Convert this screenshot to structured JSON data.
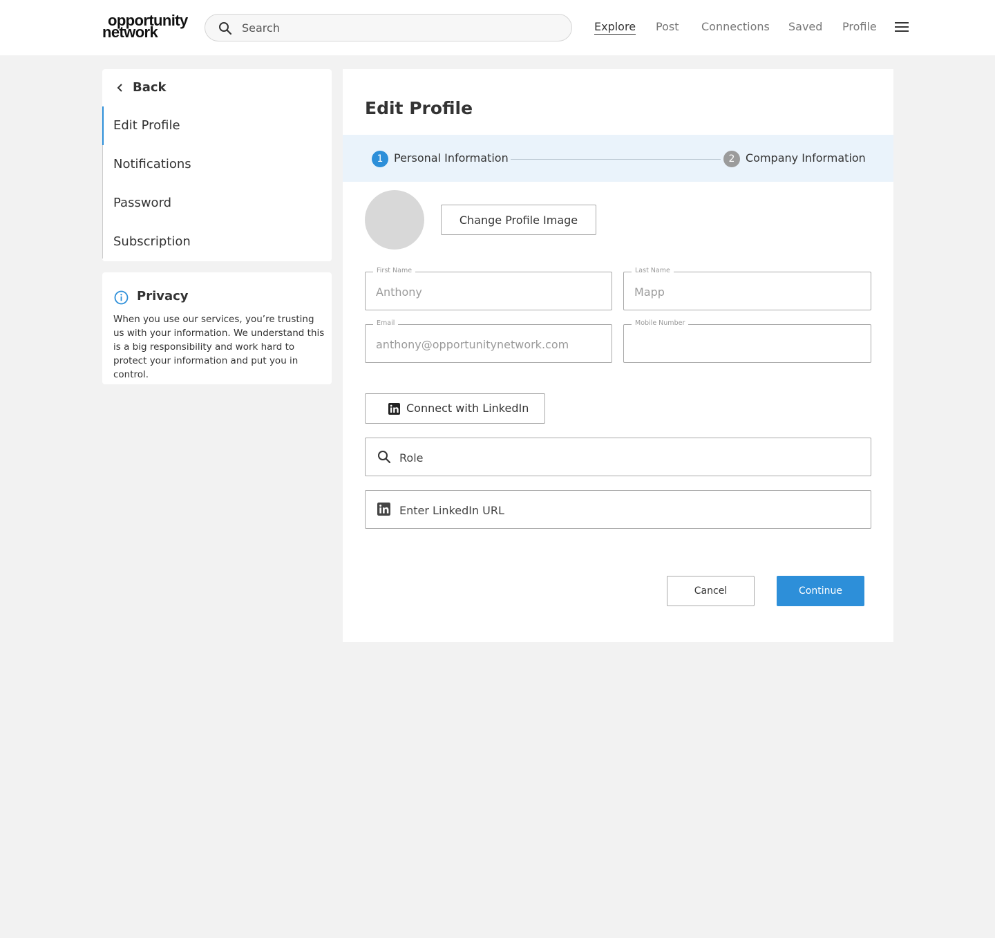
{
  "header": {
    "logo_line1": "opportunity",
    "logo_line2": "network",
    "search_placeholder": "Search",
    "nav": [
      "Explore",
      "Post",
      "Connections",
      "Saved",
      "Profile"
    ],
    "active_nav": "Explore"
  },
  "sidebar": {
    "back_label": "Back",
    "items": [
      "Edit Profile",
      "Notifications",
      "Password",
      "Subscription"
    ],
    "active_item": "Edit Profile"
  },
  "privacy": {
    "title": "Privacy",
    "text": "When you use our services, you’re trusting us with your information. We understand this is a big responsibility and work hard to protect your information and put you in control."
  },
  "main": {
    "title": "Edit Profile",
    "steps": [
      {
        "number": "1",
        "label": "Personal Information",
        "active": true
      },
      {
        "number": "2",
        "label": "Company Information",
        "active": false
      }
    ],
    "change_image_label": "Change Profile Image",
    "fields": {
      "first_name": {
        "label": "First Name",
        "value": "Anthony"
      },
      "last_name": {
        "label": "Last Name",
        "value": "Mapp"
      },
      "email": {
        "label": "Email",
        "value": "anthony@opportunitynetwork.com"
      },
      "mobile": {
        "label": "Mobile Number",
        "value": ""
      }
    },
    "connect_linkedin_label": "Connect with LinkedIn",
    "role_placeholder": "Role",
    "linkedin_url_placeholder": "Enter LinkedIn URL",
    "cancel_label": "Cancel",
    "continue_label": "Continue"
  },
  "colors": {
    "accent": "#2d8fd9",
    "step_inactive": "#9b9b9b",
    "stepper_bg": "#eaf3fb",
    "page_bg": "#f2f2f2"
  },
  "icons": {
    "search": "search-icon",
    "menu": "hamburger-menu-icon",
    "back": "chevron-left-icon",
    "info": "info-icon",
    "linkedin": "linkedin-icon"
  }
}
